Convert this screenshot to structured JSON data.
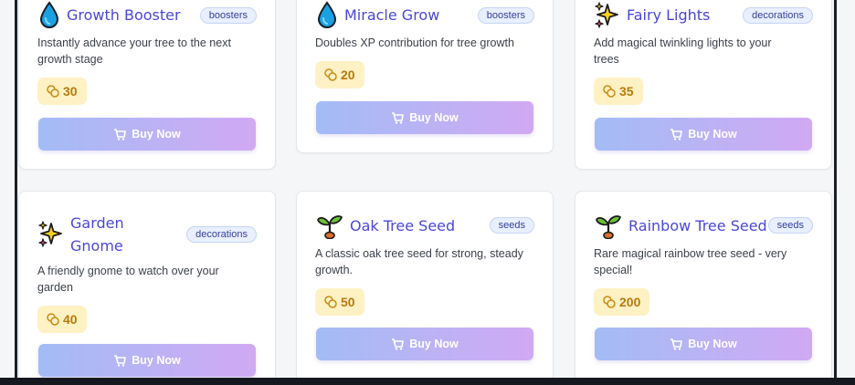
{
  "colors": {
    "name": "#4a47d6",
    "tag_bg": "#e8efff",
    "price_bg": "#fef1c4",
    "price_text": "#b67a0e",
    "button_gradient_start": "#a3bcf6",
    "button_gradient_end": "#d1a9f3"
  },
  "items": [
    {
      "name": "Growth Booster",
      "category": "boosters",
      "description": "Instantly advance your tree to the next growth stage",
      "price": "30",
      "icon": "water-drop-icon",
      "buy_label": "Buy Now"
    },
    {
      "name": "Miracle Grow",
      "category": "boosters",
      "description": "Doubles XP contribution for tree growth",
      "price": "20",
      "icon": "water-drop-icon",
      "buy_label": "Buy Now"
    },
    {
      "name": "Fairy Lights",
      "category": "decorations",
      "description": "Add magical twinkling lights to your trees",
      "price": "35",
      "icon": "sparkles-icon",
      "buy_label": "Buy Now"
    },
    {
      "name": "Garden Gnome",
      "category": "decorations",
      "description": "A friendly gnome to watch over your garden",
      "price": "40",
      "icon": "sparkles-icon",
      "buy_label": "Buy Now"
    },
    {
      "name": "Oak Tree Seed",
      "category": "seeds",
      "description": "A classic oak tree seed for strong, steady growth.",
      "price": "50",
      "icon": "seedling-icon",
      "buy_label": "Buy Now"
    },
    {
      "name": "Rainbow Tree Seed",
      "category": "seeds",
      "description": "Rare magical rainbow tree seed - very special!",
      "price": "200",
      "icon": "seedling-icon",
      "buy_label": "Buy Now"
    }
  ]
}
